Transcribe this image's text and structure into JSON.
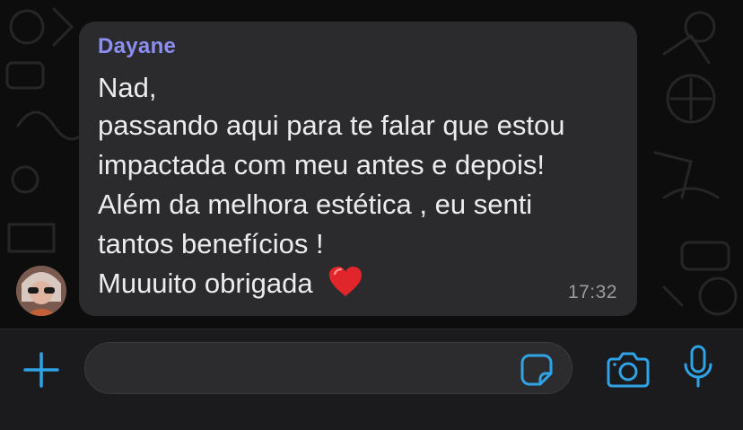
{
  "conversation": {
    "message": {
      "sender": "Dayane",
      "lines": [
        "Nad,",
        "passando aqui para te falar que estou",
        "impactada com meu antes e depois!",
        "Além da melhora estética , eu senti",
        "tantos benefícios !",
        "Muuuito obrigada"
      ],
      "emoji": "red-heart",
      "time": "17:32"
    }
  },
  "composer": {
    "input_value": "",
    "icons": [
      "plus-icon",
      "sticker-icon",
      "camera-icon",
      "microphone-icon"
    ],
    "accent_color": "#2fa3e6"
  },
  "colors": {
    "bubble": "#2b2b2d",
    "sender_name": "#8c8ef0",
    "message_text": "#ececee",
    "timestamp": "#9b9ba0",
    "background": "#0d0d0d"
  }
}
